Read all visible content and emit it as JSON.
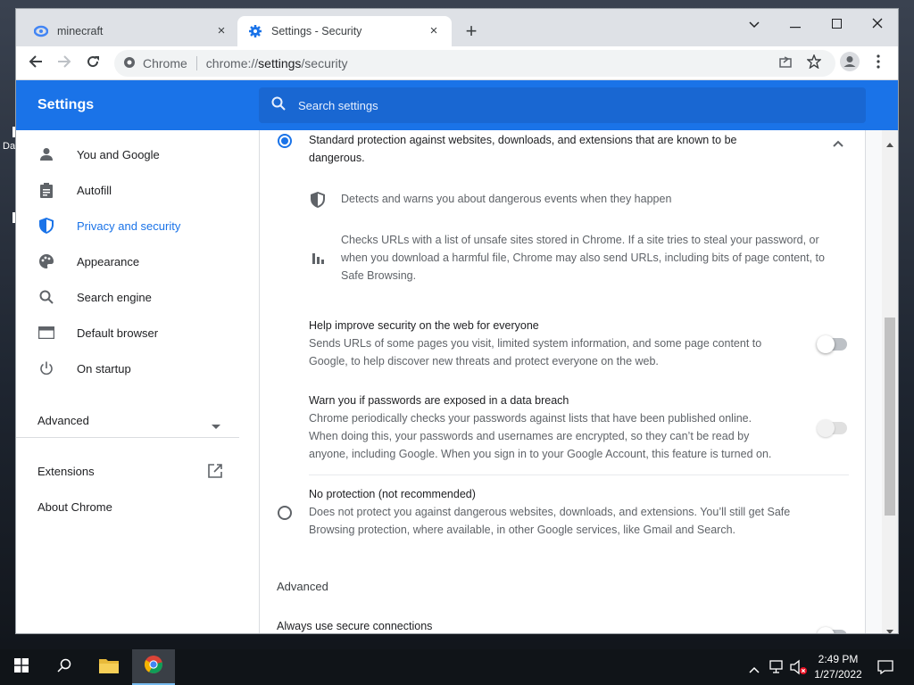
{
  "desktop": {
    "label": "Da"
  },
  "tabs": [
    {
      "title": "minecraft",
      "close": "×"
    },
    {
      "title": "Settings - Security",
      "close": "×"
    }
  ],
  "newtab": "+",
  "omnibox": {
    "site": "Chrome",
    "scheme": "chrome://",
    "host": "settings",
    "path": "/security"
  },
  "header": {
    "title": "Settings",
    "search_placeholder": "Search settings"
  },
  "sidebar": {
    "items": [
      {
        "label": "You and Google",
        "icon": "person-icon"
      },
      {
        "label": "Autofill",
        "icon": "clipboard-icon"
      },
      {
        "label": "Privacy and security",
        "icon": "shield-icon",
        "selected": true
      },
      {
        "label": "Appearance",
        "icon": "palette-icon"
      },
      {
        "label": "Search engine",
        "icon": "search-icon"
      },
      {
        "label": "Default browser",
        "icon": "browser-icon"
      },
      {
        "label": "On startup",
        "icon": "power-icon"
      }
    ],
    "advanced": "Advanced",
    "extensions": "Extensions",
    "about": "About Chrome"
  },
  "content": {
    "standard": {
      "line1": "Standard protection against websites, downloads, and extensions that are known to be",
      "line2": "dangerous."
    },
    "detects": "Detects and warns you about dangerous events when they happen",
    "checks": {
      "line1": "Checks URLs with a list of unsafe sites stored in Chrome. If a site tries to steal your password, or",
      "line2": "when you download a harmful file, Chrome may also send URLs, including bits of page content, to",
      "line3": "Safe Browsing."
    },
    "help": {
      "title": "Help improve security on the web for everyone",
      "line1": "Sends URLs of some pages you visit, limited system information, and some page content to",
      "line2": "Google, to help discover new threats and protect everyone on the web."
    },
    "warn": {
      "title": "Warn you if passwords are exposed in a data breach",
      "line1": "Chrome periodically checks your passwords against lists that have been published online.",
      "line2": "When doing this, your passwords and usernames are encrypted, so they can’t be read by",
      "line3": "anyone, including Google. When you sign in to your Google Account, this feature is turned on."
    },
    "noprot": {
      "title": "No protection (not recommended)",
      "line1": "Does not protect you against dangerous websites, downloads, and extensions. You’ll still get Safe",
      "line2": "Browsing protection, where available, in other Google services, like Gmail and Search."
    },
    "advanced_heading": "Advanced",
    "secure": "Always use secure connections"
  },
  "taskbar": {
    "time": "2:49 PM",
    "date": "1/27/2022"
  },
  "colors": {
    "accent": "#1a73e8",
    "header": "#1a73e8",
    "search": "#1967d2"
  }
}
